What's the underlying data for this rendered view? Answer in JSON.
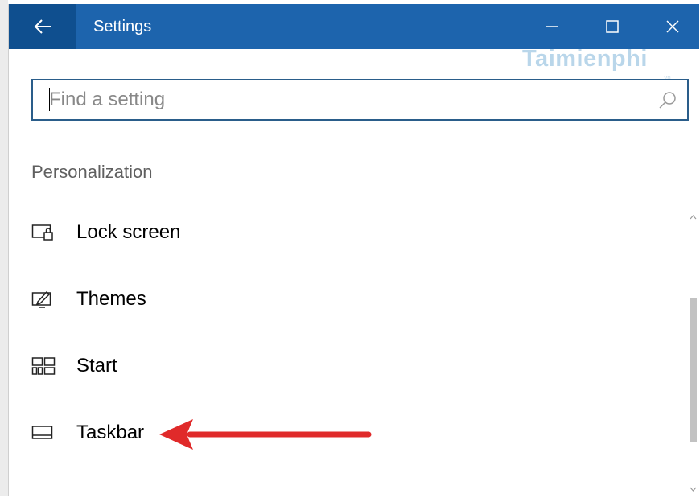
{
  "window": {
    "title": "Settings",
    "accent_color": "#1d64ad",
    "back_tile_color": "#0f4f8f",
    "icons": {
      "back": "arrow-left-icon",
      "minimize": "minimize-icon",
      "maximize": "maximize-icon",
      "close": "close-icon"
    }
  },
  "watermark": {
    "text": "Taimienphi",
    "sub": ".vn"
  },
  "search": {
    "placeholder": "Find a setting",
    "icon": "search-icon"
  },
  "section": {
    "title": "Personalization"
  },
  "items": [
    {
      "label": "Lock screen",
      "icon": "lock-screen-icon"
    },
    {
      "label": "Themes",
      "icon": "themes-icon"
    },
    {
      "label": "Start",
      "icon": "start-icon"
    },
    {
      "label": "Taskbar",
      "icon": "taskbar-icon"
    }
  ],
  "annotation": {
    "arrow_color": "#e02a2a",
    "points_to": "Taskbar"
  }
}
